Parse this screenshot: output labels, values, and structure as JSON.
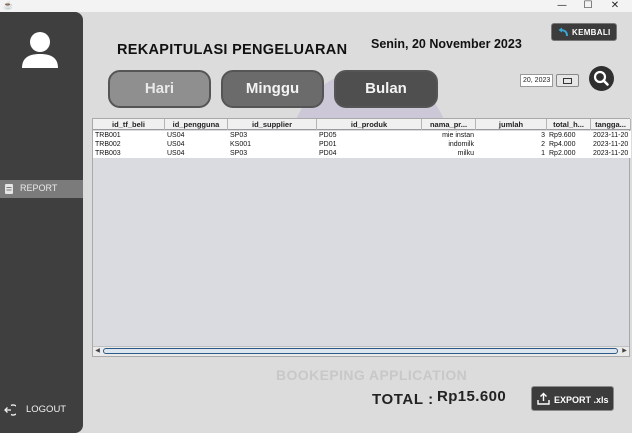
{
  "window": {
    "minimize": "—",
    "maximize": "☐",
    "close": "✕"
  },
  "sidebar": {
    "report_label": "REPORT",
    "logout_label": "LOGOUT"
  },
  "header": {
    "title": "REKAPITULASI PENGELUARAN",
    "date": "Senin, 20 November 2023",
    "back_label": "KEMBALI"
  },
  "filters": {
    "hari": "Hari",
    "minggu": "Minggu",
    "bulan": "Bulan",
    "date_value": "20, 2023"
  },
  "table": {
    "columns": [
      "id_tf_beli",
      "id_pengguna",
      "id_supplier",
      "id_produk",
      "nama_pr...",
      "jumlah",
      "total_h...",
      "tangga..."
    ],
    "rows": [
      [
        "TRB001",
        "US04",
        "SP03",
        "PD05",
        "mie instan",
        "3",
        "Rp9.600",
        "2023-11-20"
      ],
      [
        "TRB002",
        "US04",
        "KS001",
        "PD01",
        "indomilk",
        "2",
        "Rp4.000",
        "2023-11-20"
      ],
      [
        "TRB003",
        "US04",
        "SP03",
        "PD04",
        "milku",
        "1",
        "Rp2.000",
        "2023-11-20"
      ]
    ]
  },
  "footer": {
    "watermark": "BOOKEPING APPLICATION",
    "total_label": "TOTAL :",
    "total_value": "Rp15.600",
    "export_label": "EXPORT .xls"
  },
  "colors": {
    "sidebar_bg": "#3f3f3f",
    "active_nav": "#7b7b7b",
    "page_bg": "#dcdcdc"
  },
  "icons": [
    "app-icon",
    "user-avatar-icon",
    "report-icon",
    "logout-icon",
    "back-arrow-icon",
    "calendar-icon",
    "search-icon",
    "upload-icon"
  ]
}
